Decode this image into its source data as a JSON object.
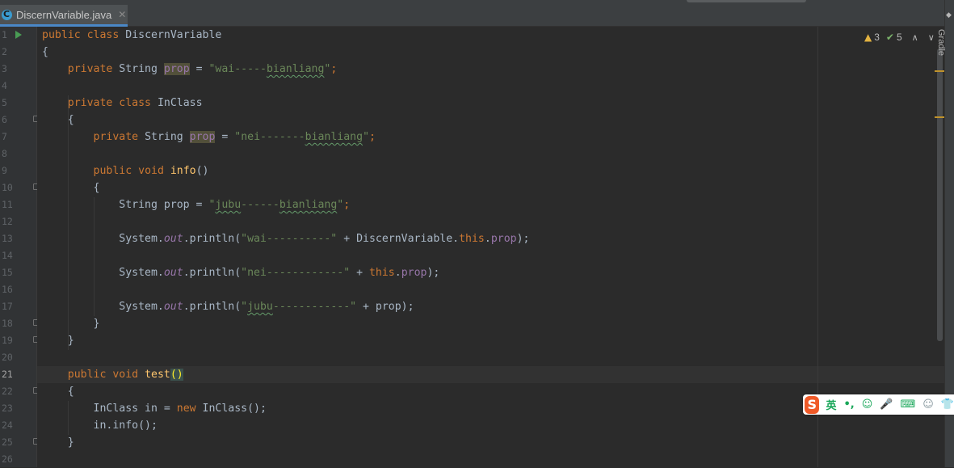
{
  "tab": {
    "file_name": "DiscernVariable.java",
    "close_glyph": "✕"
  },
  "tool_window": {
    "gradle_label": "Gradle"
  },
  "inspections": {
    "warnings": "3",
    "weak_warnings": "5"
  },
  "gutter": {
    "line_numbers": [
      "1",
      "2",
      "3",
      "4",
      "5",
      "6",
      "7",
      "8",
      "9",
      "10",
      "11",
      "12",
      "13",
      "14",
      "15",
      "16",
      "17",
      "18",
      "19",
      "20",
      "21",
      "22",
      "23",
      "24",
      "25",
      "26"
    ],
    "current_line": "21"
  },
  "code": {
    "l1_public": "public",
    "l1_class": "class",
    "l1_name": "DiscernVariable",
    "l2_brace": "{",
    "l3_private": "private",
    "l3_type": "String",
    "l3_field": "prop",
    "l3_eq": " = ",
    "l3_str_a": "\"wai-----",
    "l3_str_b": "bianliang",
    "l3_str_c": "\"",
    "l3_semi": ";",
    "l5_private": "private",
    "l5_class": "class",
    "l5_name": "InClass",
    "l6_brace": "{",
    "l7_private": "private",
    "l7_type": "String",
    "l7_field": "prop",
    "l7_eq": " = ",
    "l7_str_a": "\"nei-------",
    "l7_str_b": "bianliang",
    "l7_str_c": "\"",
    "l7_semi": ";",
    "l9_public": "public",
    "l9_void": "void",
    "l9_method": "info",
    "l9_parens": "()",
    "l10_brace": "{",
    "l11_type": "String",
    "l11_var": " prop = ",
    "l11_str_q": "\"",
    "l11_str_a": "jubu",
    "l11_str_b": "------",
    "l11_str_c": "bianliang",
    "l11_str_d": "\"",
    "l11_semi": ";",
    "l13_sys": "System.",
    "l13_out": "out",
    "l13_call": ".println(",
    "l13_str": "\"wai----------\"",
    "l13_plus": " + DiscernVariable.",
    "l13_this": "this",
    "l13_dot": ".",
    "l13_field": "prop",
    "l13_end": ");",
    "l15_sys": "System.",
    "l15_out": "out",
    "l15_call": ".println(",
    "l15_str": "\"nei------------\"",
    "l15_plus": " + ",
    "l15_this": "this",
    "l15_dot": ".",
    "l15_field": "prop",
    "l15_end": ");",
    "l17_sys": "System.",
    "l17_out": "out",
    "l17_call": ".println(",
    "l17_str_q": "\"",
    "l17_str_a": "jubu",
    "l17_str_b": "------------\"",
    "l17_plus": " + prop);",
    "l18_brace": "}",
    "l19_brace": "}",
    "l21_public": "public",
    "l21_void": "void",
    "l21_method": "test",
    "l21_paren_open": "(",
    "l21_paren_close": ")",
    "l22_brace": "{",
    "l23_type": "InClass in = ",
    "l23_new": "new",
    "l23_rest": " InClass();",
    "l24_text": "in.info();",
    "l25_brace": "}"
  },
  "ime": {
    "logo": "S",
    "mode": "英",
    "punct": "•,",
    "emoji": "☺",
    "mic": "🎤",
    "keyboard": "⌨",
    "skin": "👕"
  },
  "colors": {
    "keyword": "#cc7832",
    "string": "#6a8759",
    "field": "#9876aa",
    "method": "#ffc66d",
    "text": "#a9b7c6",
    "background": "#2b2b2b"
  }
}
